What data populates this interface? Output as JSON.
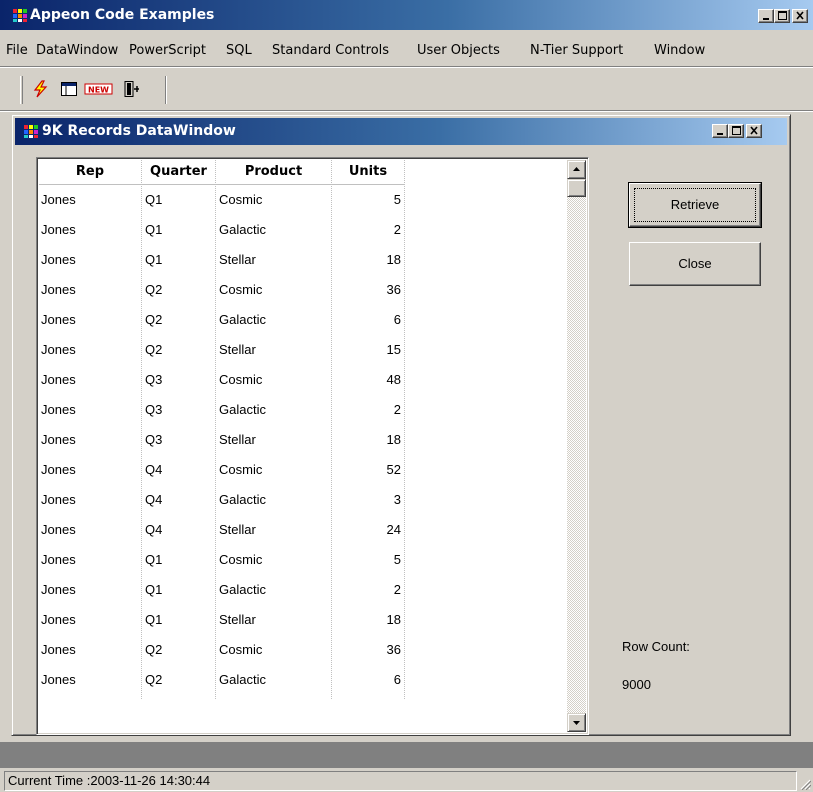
{
  "app": {
    "title": "Appeon Code Examples"
  },
  "menu": [
    "File",
    "DataWindow",
    "PowerScript",
    "SQL",
    "Standard Controls",
    "User Objects",
    "N-Tier Support",
    "Window"
  ],
  "toolbar": {
    "buttons": [
      "lightning-run-icon",
      "window-layout-icon",
      "new-icon",
      "exit-door-icon"
    ],
    "new_label": "NEW"
  },
  "child_window": {
    "title": "9K Records DataWindow"
  },
  "grid": {
    "columns": [
      "Rep",
      "Quarter",
      "Product",
      "Units"
    ],
    "rows": [
      [
        "Jones",
        "Q1",
        "Cosmic",
        "5"
      ],
      [
        "Jones",
        "Q1",
        "Galactic",
        "2"
      ],
      [
        "Jones",
        "Q1",
        "Stellar",
        "18"
      ],
      [
        "Jones",
        "Q2",
        "Cosmic",
        "36"
      ],
      [
        "Jones",
        "Q2",
        "Galactic",
        "6"
      ],
      [
        "Jones",
        "Q2",
        "Stellar",
        "15"
      ],
      [
        "Jones",
        "Q3",
        "Cosmic",
        "48"
      ],
      [
        "Jones",
        "Q3",
        "Galactic",
        "2"
      ],
      [
        "Jones",
        "Q3",
        "Stellar",
        "18"
      ],
      [
        "Jones",
        "Q4",
        "Cosmic",
        "52"
      ],
      [
        "Jones",
        "Q4",
        "Galactic",
        "3"
      ],
      [
        "Jones",
        "Q4",
        "Stellar",
        "24"
      ],
      [
        "Jones",
        "Q1",
        "Cosmic",
        "5"
      ],
      [
        "Jones",
        "Q1",
        "Galactic",
        "2"
      ],
      [
        "Jones",
        "Q1",
        "Stellar",
        "18"
      ],
      [
        "Jones",
        "Q2",
        "Cosmic",
        "36"
      ],
      [
        "Jones",
        "Q2",
        "Galactic",
        "6"
      ]
    ]
  },
  "buttons": {
    "retrieve": "Retrieve",
    "close": "Close"
  },
  "row_count": {
    "label": "Row Count:",
    "value": "9000"
  },
  "status": {
    "text": "Current Time :2003-11-26 14:30:44"
  },
  "colors": {
    "titlebar_active": "#0a246a",
    "titlebar_gradient_end": "#a6caf0",
    "face": "#d4d0c8",
    "mdi_background": "#808080"
  }
}
